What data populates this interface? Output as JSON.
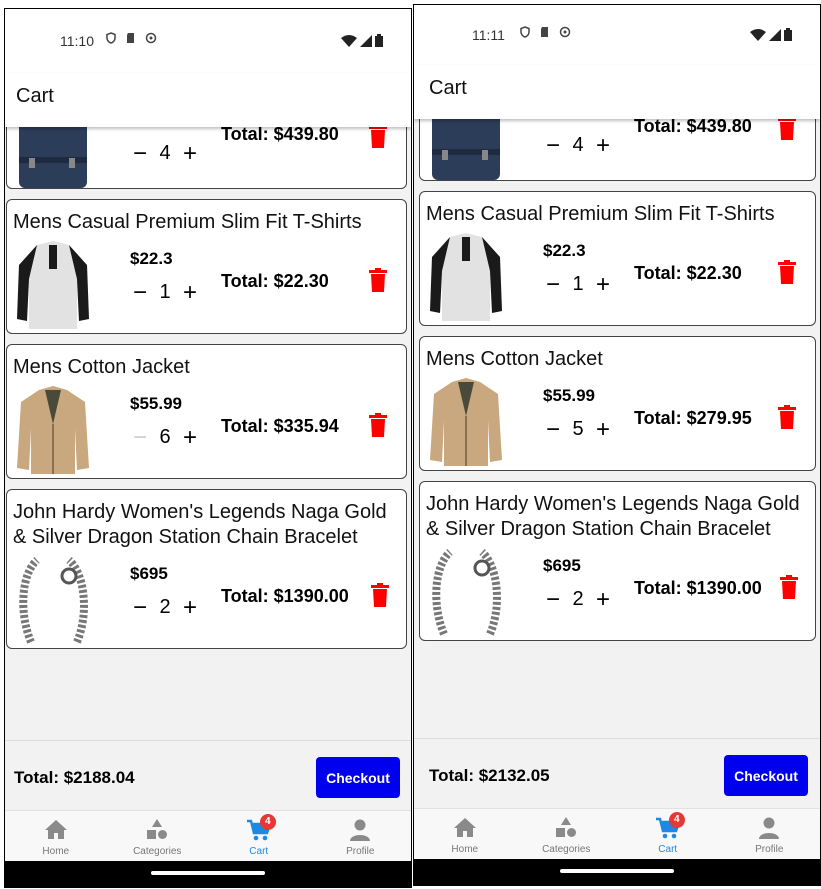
{
  "screens": [
    {
      "status": {
        "time": "11:10"
      },
      "header": {
        "title": "Cart"
      },
      "items": [
        {
          "title": "",
          "price": "",
          "qty": "4",
          "total": "Total: $439.80",
          "image": "backpack",
          "minus_disabled": false
        },
        {
          "title": "Mens Casual Premium Slim Fit T-Shirts",
          "price": "$22.3",
          "qty": "1",
          "total": "Total: $22.30",
          "image": "tshirt",
          "minus_disabled": false
        },
        {
          "title": "Mens Cotton Jacket",
          "price": "$55.99",
          "qty": "6",
          "total": "Total: $335.94",
          "image": "jacket",
          "minus_disabled": true
        },
        {
          "title": "John Hardy Women's Legends Naga Gold & Silver Dragon Station Chain Bracelet",
          "price": "$695",
          "qty": "2",
          "total": "Total: $1390.00",
          "image": "bracelet",
          "minus_disabled": false
        }
      ],
      "footer": {
        "total": "Total: $2188.04",
        "checkout_label": "Checkout"
      },
      "tabs": [
        {
          "label": "Home",
          "icon": "home-icon"
        },
        {
          "label": "Categories",
          "icon": "categories-icon"
        },
        {
          "label": "Cart",
          "icon": "cart-icon",
          "badge": "4",
          "active": true
        },
        {
          "label": "Profile",
          "icon": "profile-icon"
        }
      ]
    },
    {
      "status": {
        "time": "11:11"
      },
      "header": {
        "title": "Cart"
      },
      "items": [
        {
          "title": "",
          "price": "",
          "qty": "4",
          "total": "Total: $439.80",
          "image": "backpack",
          "minus_disabled": false
        },
        {
          "title": "Mens Casual Premium Slim Fit T-Shirts",
          "price": "$22.3",
          "qty": "1",
          "total": "Total: $22.30",
          "image": "tshirt",
          "minus_disabled": false
        },
        {
          "title": "Mens Cotton Jacket",
          "price": "$55.99",
          "qty": "5",
          "total": "Total: $279.95",
          "image": "jacket",
          "minus_disabled": false
        },
        {
          "title": "John Hardy Women's Legends Naga Gold & Silver Dragon Station Chain Bracelet",
          "price": "$695",
          "qty": "2",
          "total": "Total: $1390.00",
          "image": "bracelet",
          "minus_disabled": false
        }
      ],
      "footer": {
        "total": "Total: $2132.05",
        "checkout_label": "Checkout"
      },
      "tabs": [
        {
          "label": "Home",
          "icon": "home-icon"
        },
        {
          "label": "Categories",
          "icon": "categories-icon"
        },
        {
          "label": "Cart",
          "icon": "cart-icon",
          "badge": "4",
          "active": true
        },
        {
          "label": "Profile",
          "icon": "profile-icon"
        }
      ]
    }
  ],
  "controls": {
    "minus": "−",
    "plus": "+"
  },
  "colors": {
    "primary": "#0000ee",
    "delete": "#ff0000",
    "active_tab": "#1e88e5",
    "badge": "#e53935"
  }
}
